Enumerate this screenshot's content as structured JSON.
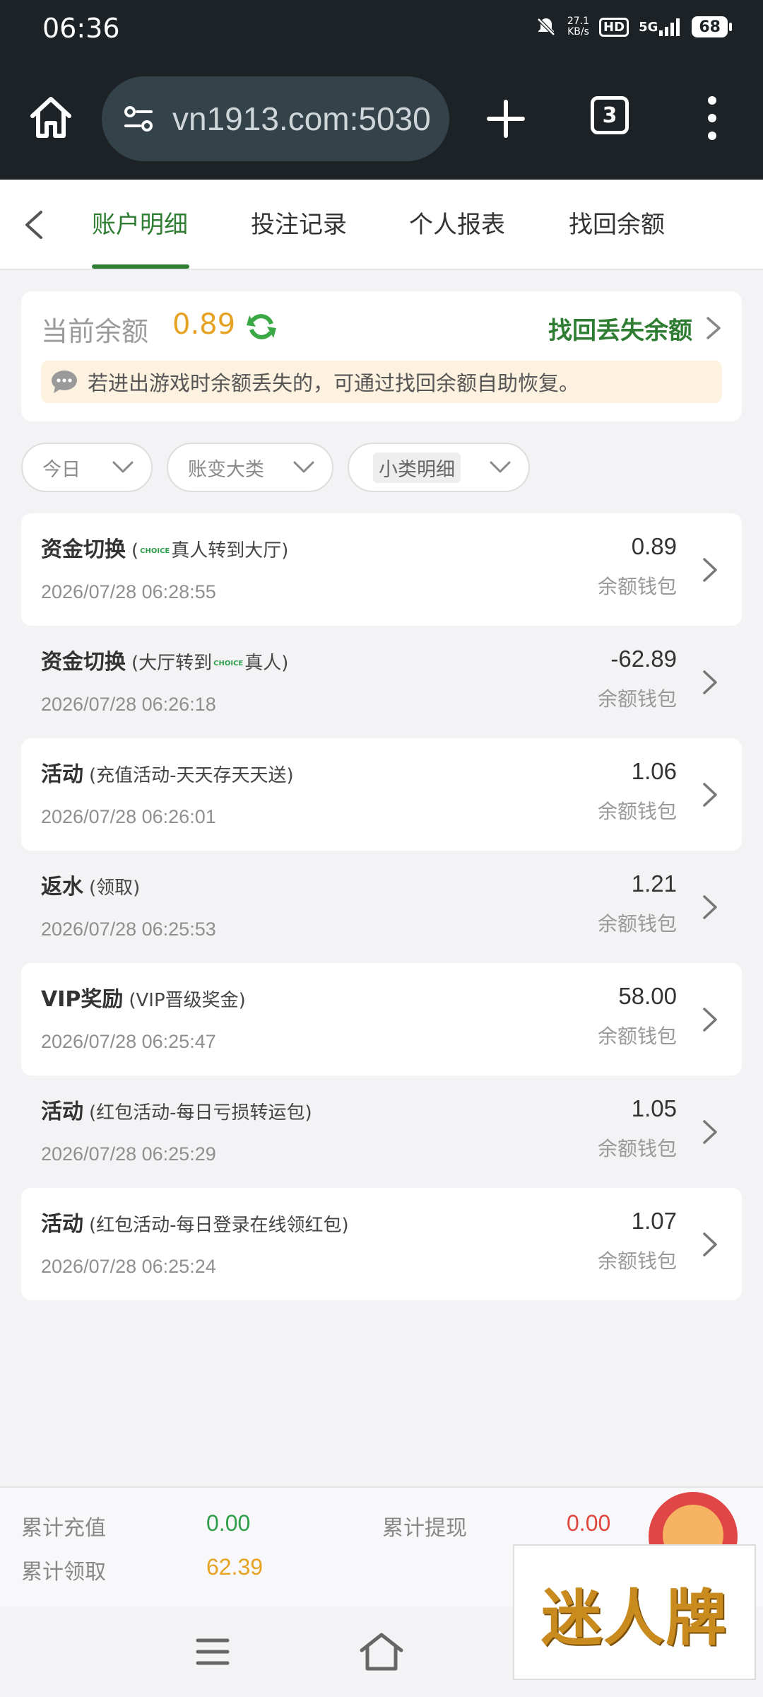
{
  "status_bar": {
    "time": "06:36",
    "net_speed": "27.1\nKB/s",
    "hd": "HD",
    "network": "5G",
    "battery": "68"
  },
  "browser": {
    "url": "vn1913.com:5030",
    "tab_count": "3",
    "icons": [
      "home-icon",
      "tune-icon",
      "plus-icon",
      "tabs-icon",
      "more-vert-icon"
    ]
  },
  "page_tabs": [
    {
      "label": "账户明细",
      "active": true
    },
    {
      "label": "投注记录",
      "active": false
    },
    {
      "label": "个人报表",
      "active": false
    },
    {
      "label": "找回余额",
      "active": false
    }
  ],
  "balance": {
    "label": "当前余额",
    "value": "0.89",
    "recover_link": "找回丢失余额",
    "notice": "若进出游戏时余额丢失的，可通过找回余额自助恢复。"
  },
  "filters": [
    "今日",
    "账变大类",
    "小类明细"
  ],
  "transactions": [
    {
      "type": "资金切换",
      "detail_pre": "(",
      "logo": "CHOICE",
      "detail_post": "真人转到大厅)",
      "time": "2026/07/28 06:28:55",
      "amount": "0.89",
      "wallet": "余额钱包"
    },
    {
      "type": "资金切换",
      "detail_pre": "(大厅转到",
      "logo": "CHOICE",
      "detail_post": "真人)",
      "time": "2026/07/28 06:26:18",
      "amount": "-62.89",
      "wallet": "余额钱包"
    },
    {
      "type": "活动",
      "detail_pre": "(充值活动-天天存天天送)",
      "logo": "",
      "detail_post": "",
      "time": "2026/07/28 06:26:01",
      "amount": "1.06",
      "wallet": "余额钱包"
    },
    {
      "type": "返水",
      "detail_pre": "(领取)",
      "logo": "",
      "detail_post": "",
      "time": "2026/07/28 06:25:53",
      "amount": "1.21",
      "wallet": "余额钱包"
    },
    {
      "type": "VIP奖励",
      "detail_pre": "(VIP晋级奖金)",
      "logo": "",
      "detail_post": "",
      "time": "2026/07/28 06:25:47",
      "amount": "58.00",
      "wallet": "余额钱包"
    },
    {
      "type": "活动",
      "detail_pre": "(红包活动-每日亏损转运包)",
      "logo": "",
      "detail_post": "",
      "time": "2026/07/28 06:25:29",
      "amount": "1.05",
      "wallet": "余额钱包"
    },
    {
      "type": "活动",
      "detail_pre": "(红包活动-每日登录在线领红包)",
      "logo": "",
      "detail_post": "",
      "time": "2026/07/28 06:25:24",
      "amount": "1.07",
      "wallet": "余额钱包"
    }
  ],
  "summary": {
    "recharge_label": "累计充值",
    "recharge_value": "0.00",
    "withdraw_label": "累计提现",
    "withdraw_value": "0.00",
    "claimed_label": "累计领取",
    "claimed_value": "62.39"
  },
  "watermark": "迷人牌",
  "colors": {
    "accent_green": "#2e7d32",
    "gold": "#e6a222",
    "red": "#e0463c",
    "chrome_dark": "#1c2226"
  }
}
